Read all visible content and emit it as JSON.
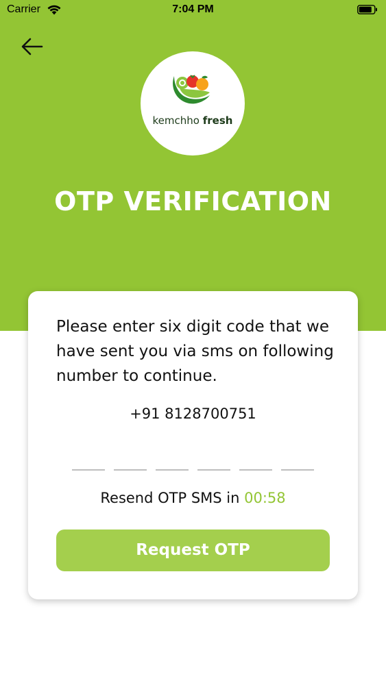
{
  "status_bar": {
    "carrier": "Carrier",
    "time": "7:04 PM",
    "icons": [
      "wifi-icon",
      "battery-icon"
    ]
  },
  "header": {
    "back_icon": "arrow-left-icon",
    "logo_text_a": "kemchho",
    "logo_text_b": "fresh",
    "title": "OTP VERIFICATION"
  },
  "card": {
    "instructions": "Please enter six digit code that we have sent you via sms on following number to continue.",
    "phone_number": "+91 8128700751",
    "otp_digits": [
      "",
      "",
      "",
      "",
      "",
      ""
    ],
    "resend_label": "Resend OTP SMS in ",
    "resend_timer": "00:58",
    "request_button_label": "Request OTP"
  },
  "colors": {
    "brand_green": "#93c534",
    "button_green": "#a4cf4d",
    "card_background": "#ffffff"
  }
}
